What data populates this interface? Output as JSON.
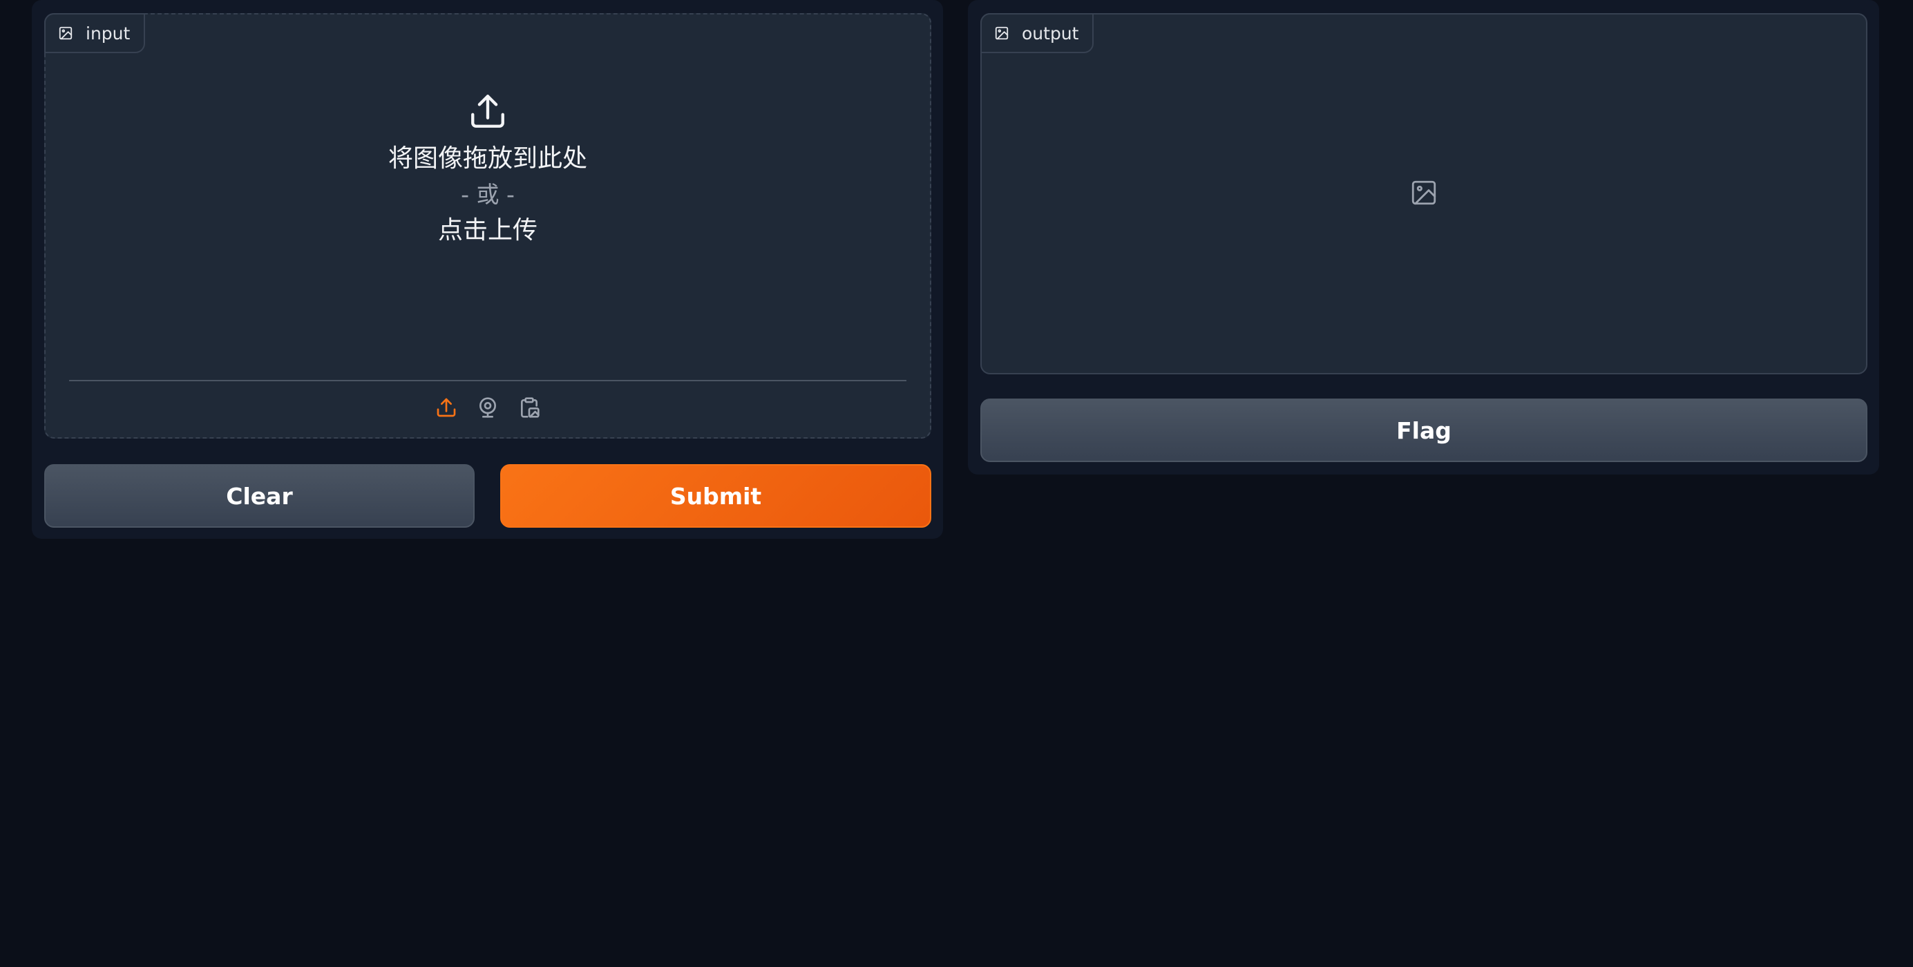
{
  "input_panel": {
    "label": "input",
    "label_icon": "image-icon",
    "drop_text": "将图像拖放到此处",
    "or_text": "- 或 -",
    "click_text": "点击上传",
    "sources": [
      {
        "name": "upload",
        "icon": "upload-icon",
        "active": true
      },
      {
        "name": "webcam",
        "icon": "webcam-icon",
        "active": false
      },
      {
        "name": "clipboard",
        "icon": "clipboard-icon",
        "active": false
      }
    ]
  },
  "output_panel": {
    "label": "output",
    "label_icon": "image-icon",
    "empty_icon": "image-placeholder-icon"
  },
  "buttons": {
    "clear_label": "Clear",
    "submit_label": "Submit",
    "flag_label": "Flag"
  },
  "colors": {
    "background": "#0b0f19",
    "panel": "#111827",
    "block": "#1f2937",
    "border": "#374151",
    "accent": "#f97316",
    "secondary_button": "#4b5563",
    "text": "#f3f4f6",
    "muted_text": "#9ca3af"
  }
}
